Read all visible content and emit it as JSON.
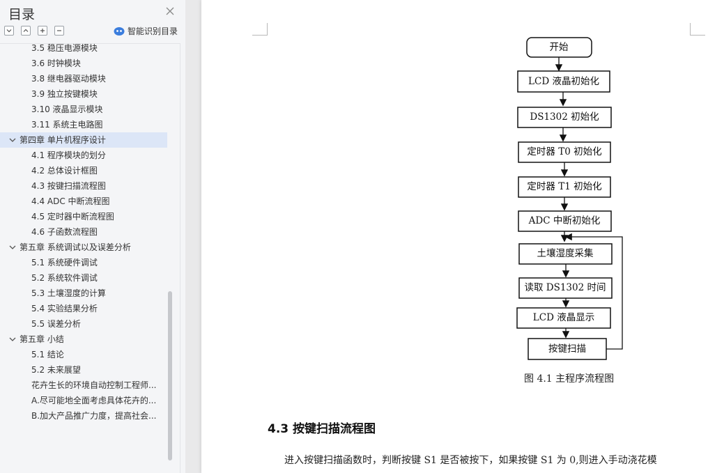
{
  "sidebar": {
    "title": "目录",
    "smart_toc_label": "智能识别目录",
    "items": [
      {
        "label": "3.5 稳压电源模块",
        "level": 2
      },
      {
        "label": "3.6 时钟模块",
        "level": 2
      },
      {
        "label": "3.8 继电器驱动模块",
        "level": 2
      },
      {
        "label": "3.9 独立按键模块",
        "level": 2
      },
      {
        "label": "3.10 液晶显示模块",
        "level": 2
      },
      {
        "label": "3.11 系统主电路图",
        "level": 2
      },
      {
        "label": "第四章 单片机程序设计",
        "level": 1,
        "selected": true
      },
      {
        "label": "4.1 程序模块的划分",
        "level": 2
      },
      {
        "label": "4.2 总体设计框图",
        "level": 2
      },
      {
        "label": "4.3 按键扫描流程图",
        "level": 2
      },
      {
        "label": "4.4 ADC 中断流程图",
        "level": 2
      },
      {
        "label": "4.5  定时器中断流程图",
        "level": 2
      },
      {
        "label": "4.6 子函数流程图",
        "level": 2
      },
      {
        "label": "第五章  系统调试以及误差分析",
        "level": 1
      },
      {
        "label": "5.1  系统硬件调试",
        "level": 2
      },
      {
        "label": "5.2  系统软件调试",
        "level": 2
      },
      {
        "label": "5.3 土壤湿度的计算",
        "level": 2
      },
      {
        "label": "5.4 实验结果分析",
        "level": 2
      },
      {
        "label": "5.5 误差分析",
        "level": 2
      },
      {
        "label": "第五章  小结",
        "level": 1
      },
      {
        "label": "5.1 结论",
        "level": 2
      },
      {
        "label": "5.2  未来展望",
        "level": 2
      },
      {
        "label": "花卉生长的环境自动控制工程师...",
        "level": 2
      },
      {
        "label": "A.尽可能地全面考虑具体花卉的...",
        "level": 2
      },
      {
        "label": "B.加大产品推广力度，提高社会...",
        "level": 2
      }
    ]
  },
  "flowchart": {
    "nodes": [
      "开始",
      "LCD 液晶初始化",
      "DS1302 初始化",
      "定时器 T0 初始化",
      "定时器 T1 初始化",
      "ADC 中断初始化",
      "土壤湿度采集",
      "读取 DS1302 时间",
      "LCD 液晶显示",
      "按键扫描"
    ],
    "caption": "图 4.1  主程序流程图"
  },
  "document": {
    "heading": "4.3 按键扫描流程图",
    "paragraph": "进入按键扫描函数时，判断按键 S1 是否被按下，如果按键 S1 为 0,则进入手动浇花模"
  },
  "colors": {
    "selected_bg": "#dce6f7",
    "sidebar_bg": "#f4f5f7",
    "smart_icon": "#3b7ddd"
  }
}
